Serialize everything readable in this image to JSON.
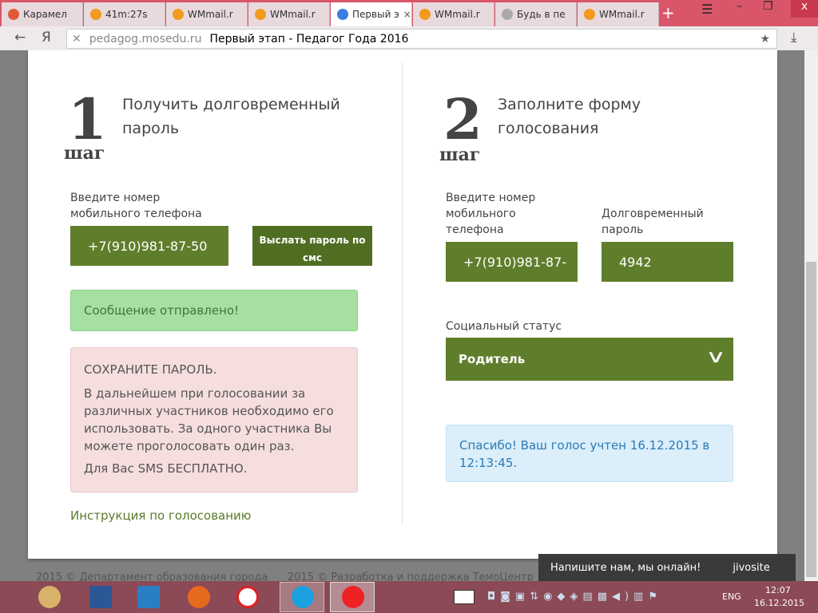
{
  "browser": {
    "tabs": [
      {
        "label": "Карамел",
        "color": "#e05a3a"
      },
      {
        "label": "41m:27s",
        "color": "#f29a1e"
      },
      {
        "label": "WMmail.r",
        "color": "#f29a1e"
      },
      {
        "label": "WMmail.r",
        "color": "#f29a1e"
      },
      {
        "label": "Первый э",
        "color": "#3a7de0",
        "active": true
      },
      {
        "label": "WMmail.r",
        "color": "#f29a1e"
      },
      {
        "label": "Будь в пе",
        "color": "#aaaaaa"
      },
      {
        "label": "WMmail.r",
        "color": "#f29a1e"
      }
    ],
    "new_tab": "+",
    "url_host": "pedagog.mosedu.ru",
    "page_title": "Первый этап - Педагог Года 2016",
    "yandex_logo": "Я"
  },
  "step1": {
    "number": "1",
    "word": "шаг",
    "title": "Получить долговременный пароль",
    "phone_label": "Введите номер мобильного телефона",
    "phone_value": "+7(910)981-87-50",
    "send_button": "Выслать пароль по смс",
    "success": "Сообщение отправлено!",
    "warn_title": "СОХРАНИТЕ ПАРОЛЬ.",
    "warn_text": "В дальнейшем при голосовании за различных участников необходимо его использовать. За одного участника Вы можете проголосовать один раз.",
    "warn_free": "Для Вас SMS БЕСПЛАТНО.",
    "instructions_link": "Инструкция по голосованию"
  },
  "step2": {
    "number": "2",
    "word": "шаг",
    "title": "Заполните форму голосования",
    "phone_label": "Введите номер мобильного телефона",
    "phone_value": "+7(910)981-87-",
    "password_label": "Долговременный пароль",
    "password_value": "4942",
    "status_label": "Социальный статус",
    "status_value": "Родитель",
    "thanks": "Спасибо! Ваш голос учтен 16.12.2015 в 12:13:45."
  },
  "footer": {
    "left": "2015 © Департамент образования города",
    "right": "2015 © Разработка и поддержка ТемоЦентр"
  },
  "chat": {
    "label": "Напишите нам, мы онлайн!",
    "brand": "jivosite"
  },
  "taskbar": {
    "lang": "ENG",
    "time": "12:07",
    "date": "16.12.2015"
  }
}
